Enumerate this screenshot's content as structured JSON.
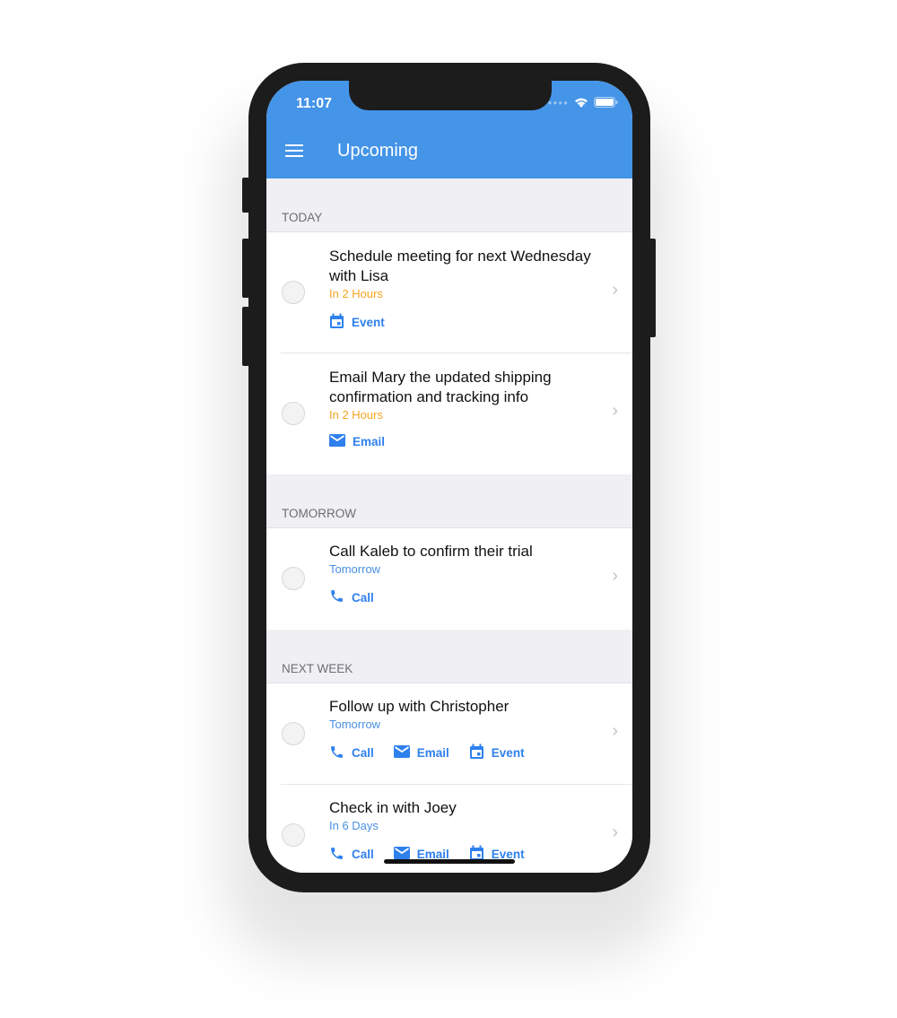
{
  "status_bar": {
    "time": "11:07",
    "icons": [
      "signal-dots-icon",
      "wifi-icon",
      "battery-icon"
    ]
  },
  "header": {
    "title": "Upcoming",
    "menu_icon": "hamburger-menu-icon",
    "color": "#4494E8"
  },
  "colors": {
    "accent": "#2F80ED",
    "orange": "#F5A623",
    "section_bg": "#EFEFF4"
  },
  "sections": [
    {
      "label": "TODAY",
      "items": [
        {
          "title": "Schedule meeting for next Wednesday with Lisa",
          "due": "In 2 Hours",
          "due_color": "#F5A623",
          "actions": [
            {
              "icon": "calendar-icon",
              "label": "Event"
            }
          ]
        },
        {
          "title": "Email Mary the updated shipping confirmation and tracking info",
          "due": "In 2 Hours",
          "due_color": "#F5A623",
          "actions": [
            {
              "icon": "email-icon",
              "label": "Email"
            }
          ]
        }
      ]
    },
    {
      "label": "TOMORROW",
      "items": [
        {
          "title": "Call Kaleb to confirm their trial",
          "due": "Tomorrow",
          "due_color": "#4A90E2",
          "actions": [
            {
              "icon": "phone-icon",
              "label": "Call"
            }
          ]
        }
      ]
    },
    {
      "label": "NEXT WEEK",
      "items": [
        {
          "title": "Follow up with Christopher",
          "due": "Tomorrow",
          "due_color": "#4A90E2",
          "actions": [
            {
              "icon": "phone-icon",
              "label": "Call"
            },
            {
              "icon": "email-icon",
              "label": "Email"
            },
            {
              "icon": "calendar-icon",
              "label": "Event"
            }
          ]
        },
        {
          "title": "Check in with Joey",
          "due": "In 6 Days",
          "due_color": "#4A90E2",
          "actions": [
            {
              "icon": "phone-icon",
              "label": "Call"
            },
            {
              "icon": "email-icon",
              "label": "Email"
            },
            {
              "icon": "calendar-icon",
              "label": "Event"
            }
          ]
        }
      ]
    }
  ]
}
